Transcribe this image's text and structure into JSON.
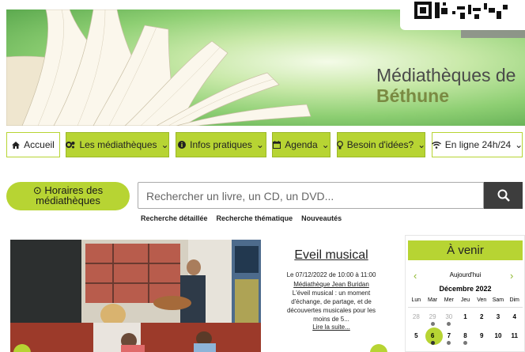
{
  "header": {
    "site_title_line1": "Médiathèques de",
    "site_title_line2": "Béthune"
  },
  "nav": [
    {
      "label": "Accueil",
      "icon": "home-icon"
    },
    {
      "label": "Les médiathèques",
      "icon": "gears-icon"
    },
    {
      "label": "Infos pratiques",
      "icon": "info-icon"
    },
    {
      "label": "Agenda",
      "icon": "calendar-icon"
    },
    {
      "label": "Besoin d'idées?",
      "icon": "lightbulb-icon"
    },
    {
      "label": "En ligne 24h/24",
      "icon": "wifi-icon"
    }
  ],
  "hours_button": {
    "line1": "Horaires des",
    "line2": "médiathèques",
    "icon": "clock-icon"
  },
  "search": {
    "placeholder": "Rechercher un livre, un CD, un DVD...",
    "icon": "search-icon"
  },
  "sublinks": [
    "Recherche détaillée",
    "Recherche thématique",
    "Nouveautés"
  ],
  "event": {
    "title": "Eveil musical",
    "date": "Le 07/12/2022 de 10:00 à 11:00",
    "place": "Médiathèque Jean Buridan",
    "description": "L'éveil musical : un moment d'échange, de partage, et de découvertes musicales pour les moins de 5...",
    "more": "Lire la suite..."
  },
  "agenda": {
    "title": "À venir",
    "today": "Aujourd'hui",
    "month": "Décembre 2022",
    "weekdays": [
      "Lun",
      "Mar",
      "Mer",
      "Jeu",
      "Ven",
      "Sam",
      "Dim"
    ],
    "row1": [
      "28",
      "29",
      "30",
      "1",
      "2",
      "3",
      "4"
    ],
    "row2": [
      "5",
      "6",
      "7",
      "8",
      "9",
      "10",
      "11"
    ],
    "selected_day": "6"
  },
  "colors": {
    "accent": "#b7d433",
    "dark": "#3d3d3d"
  }
}
